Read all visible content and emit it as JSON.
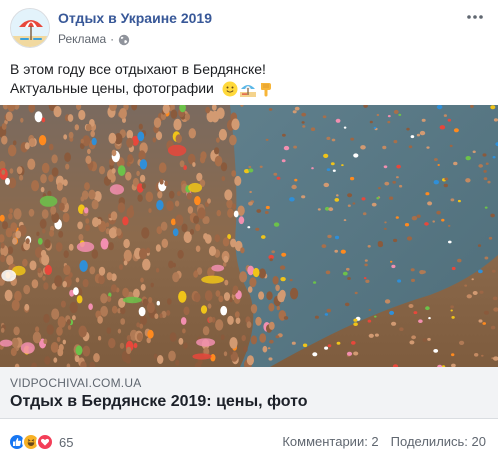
{
  "header": {
    "page_name": "Отдых в Украине 2019",
    "sponsored": "Реклама",
    "separator": "·",
    "more": "•••"
  },
  "post": {
    "text_line1": "В этом году все отдыхают в Бердянске!",
    "text_line2": "Актуальные цены, фотографии",
    "emojis": [
      "slightly-smiling-face",
      "beach-umbrella",
      "pointing-down-hand"
    ]
  },
  "link_preview": {
    "domain": "VIDPOCHIVAI.COM.UA",
    "title": "Отдых в Бердянске 2019: цены, фото"
  },
  "footer": {
    "reactions": [
      "like",
      "haha",
      "love"
    ],
    "reaction_count": "65",
    "comments": "Комментарии: 2",
    "shares": "Поделились: 20"
  },
  "colors": {
    "link_blue": "#385898",
    "like_blue": "#1877f2",
    "haha_yellow": "#f7b125",
    "love_red": "#f33e58",
    "meta_gray": "#616770",
    "preview_bg": "#f2f3f5"
  }
}
